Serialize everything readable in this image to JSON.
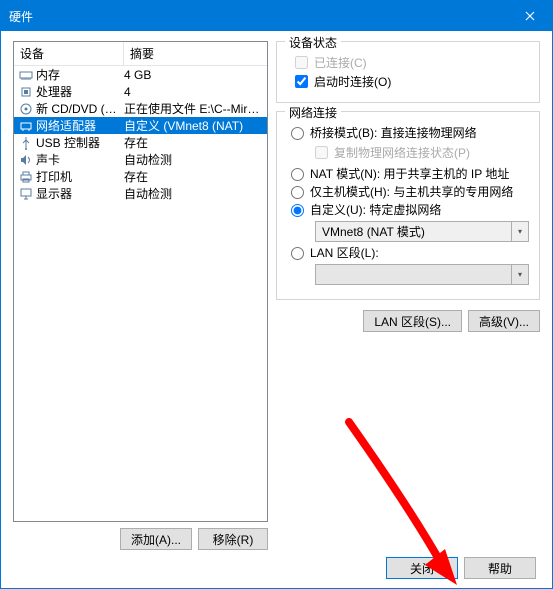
{
  "window": {
    "title": "硬件"
  },
  "columns": {
    "device": "设备",
    "summary": "摘要"
  },
  "devices": [
    {
      "icon": "memory",
      "name": "内存",
      "value": "4 GB",
      "selected": false
    },
    {
      "icon": "cpu",
      "name": "处理器",
      "value": "4",
      "selected": false
    },
    {
      "icon": "disc",
      "name": "新 CD/DVD (SATA)",
      "value": "正在使用文件 E:\\C--Mirror im...",
      "selected": false
    },
    {
      "icon": "net",
      "name": "网络适配器",
      "value": "自定义 (VMnet8 (NAT)",
      "selected": true
    },
    {
      "icon": "usb",
      "name": "USB 控制器",
      "value": "存在",
      "selected": false
    },
    {
      "icon": "sound",
      "name": "声卡",
      "value": "自动检测",
      "selected": false
    },
    {
      "icon": "printer",
      "name": "打印机",
      "value": "存在",
      "selected": false
    },
    {
      "icon": "display",
      "name": "显示器",
      "value": "自动检测",
      "selected": false
    }
  ],
  "left_buttons": {
    "add": "添加(A)...",
    "remove": "移除(R)"
  },
  "status": {
    "legend": "设备状态",
    "connected": "已连接(C)",
    "connect_on_start": "启动时连接(O)",
    "connected_checked": false,
    "connected_disabled": true,
    "start_checked": true
  },
  "netconn": {
    "legend": "网络连接",
    "bridged": "桥接模式(B): 直接连接物理网络",
    "replicate": "复制物理网络连接状态(P)",
    "nat": "NAT 模式(N): 用于共享主机的 IP 地址",
    "host_only": "仅主机模式(H): 与主机共享的专用网络",
    "custom": "自定义(U): 特定虚拟网络",
    "custom_value": "VMnet8 (NAT 模式)",
    "lan": "LAN 区段(L):",
    "lan_value": "",
    "selected": "custom"
  },
  "right_buttons": {
    "lan_seg": "LAN 区段(S)...",
    "advanced": "高级(V)..."
  },
  "footer": {
    "close": "关闭",
    "help": "帮助"
  }
}
